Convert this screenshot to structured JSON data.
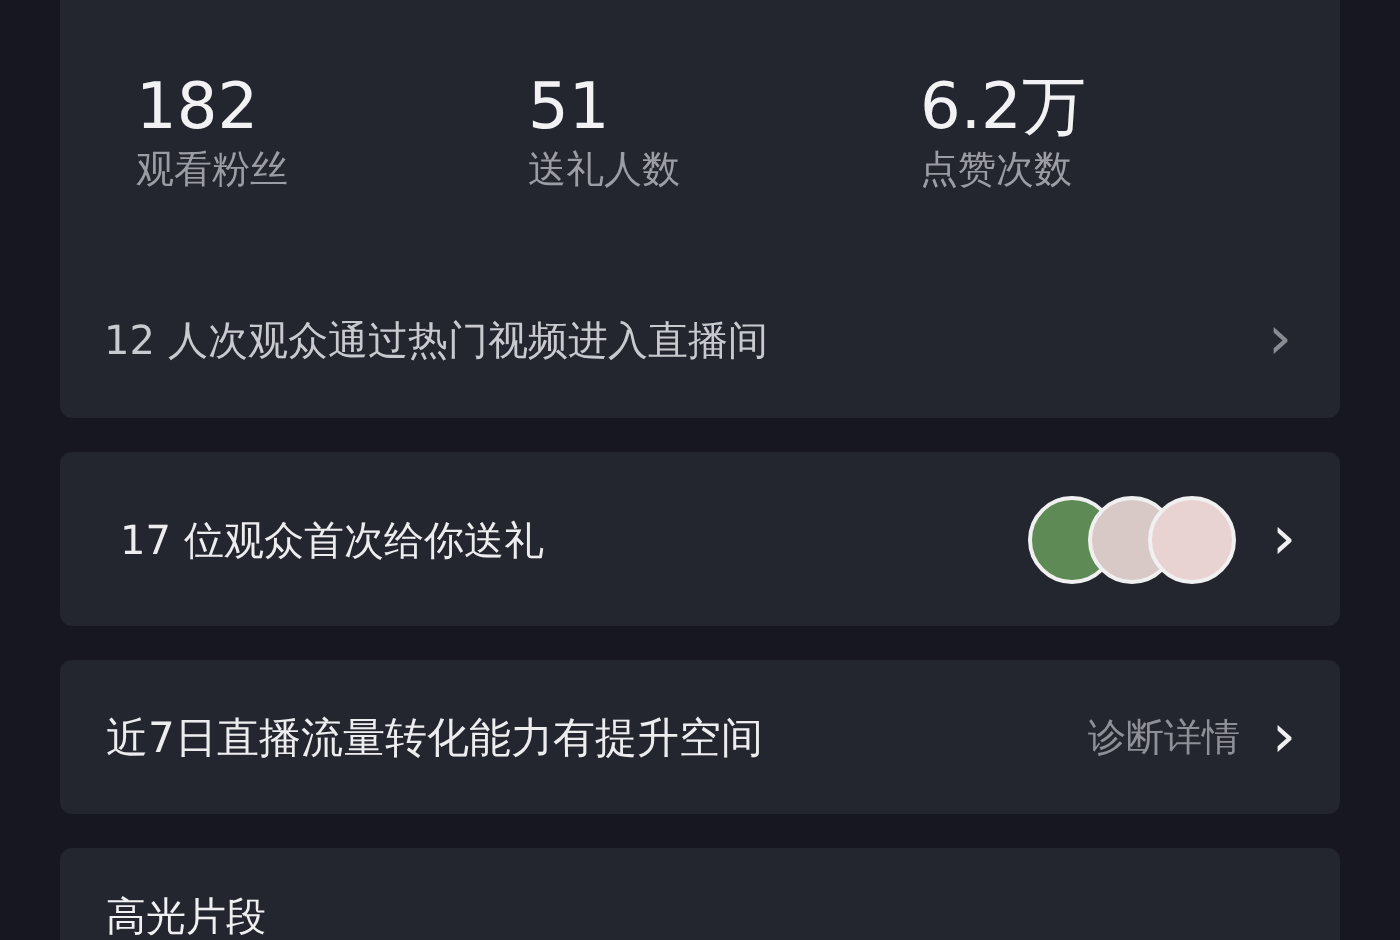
{
  "stats": [
    {
      "value": "182",
      "label": "观看粉丝"
    },
    {
      "value": "51",
      "label": "送礼人数"
    },
    {
      "value": "6.2万",
      "label": "点赞次数"
    }
  ],
  "traffic_row": {
    "text": "12 人次观众通过热门视频进入直播间",
    "chevron": "›"
  },
  "gift_row": {
    "text": "17 位观众首次给你送礼",
    "avatars": [
      {
        "kind": "photo"
      },
      {
        "kind": "photo"
      },
      {
        "kind": "photo"
      }
    ],
    "chevron": "›"
  },
  "diagnosis_row": {
    "text": "近7日直播流量转化能力有提升空间",
    "action": "诊断详情",
    "chevron": "›"
  },
  "highlights": {
    "title": "高光片段"
  }
}
